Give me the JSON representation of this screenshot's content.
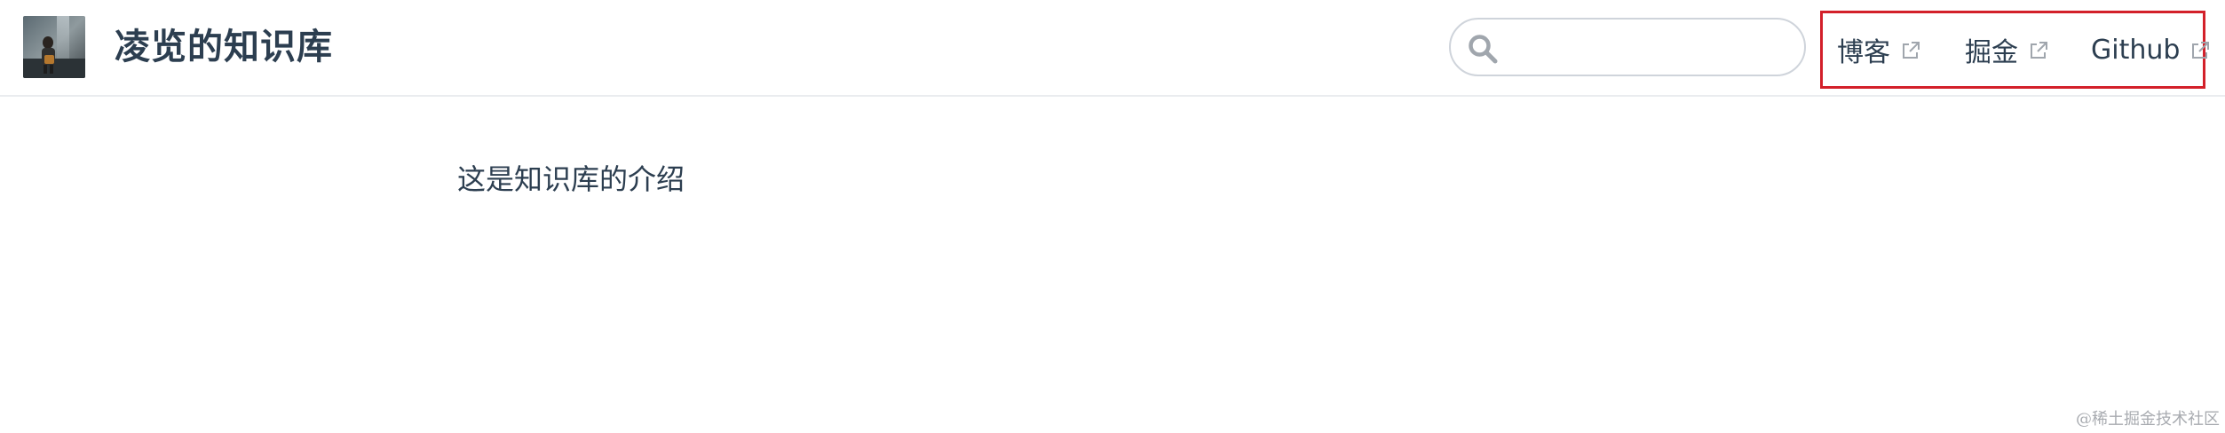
{
  "header": {
    "site_title": "凌览的知识库",
    "logo_icon": "avatar-logo-icon",
    "search": {
      "placeholder": "",
      "value": "",
      "icon": "search-icon"
    },
    "nav_links": [
      {
        "label": "博客",
        "icon": "external-link-icon"
      },
      {
        "label": "掘金",
        "icon": "external-link-icon"
      },
      {
        "label": "Github",
        "icon": "external-link-icon"
      }
    ],
    "highlight_color": "#d3202a"
  },
  "main": {
    "intro_text": "这是知识库的介绍"
  },
  "watermark": {
    "text": "@稀土掘金技术社区"
  },
  "colors": {
    "text": "#2c3e50",
    "border": "#eaecef",
    "icon_gray": "#a0a6ad"
  }
}
